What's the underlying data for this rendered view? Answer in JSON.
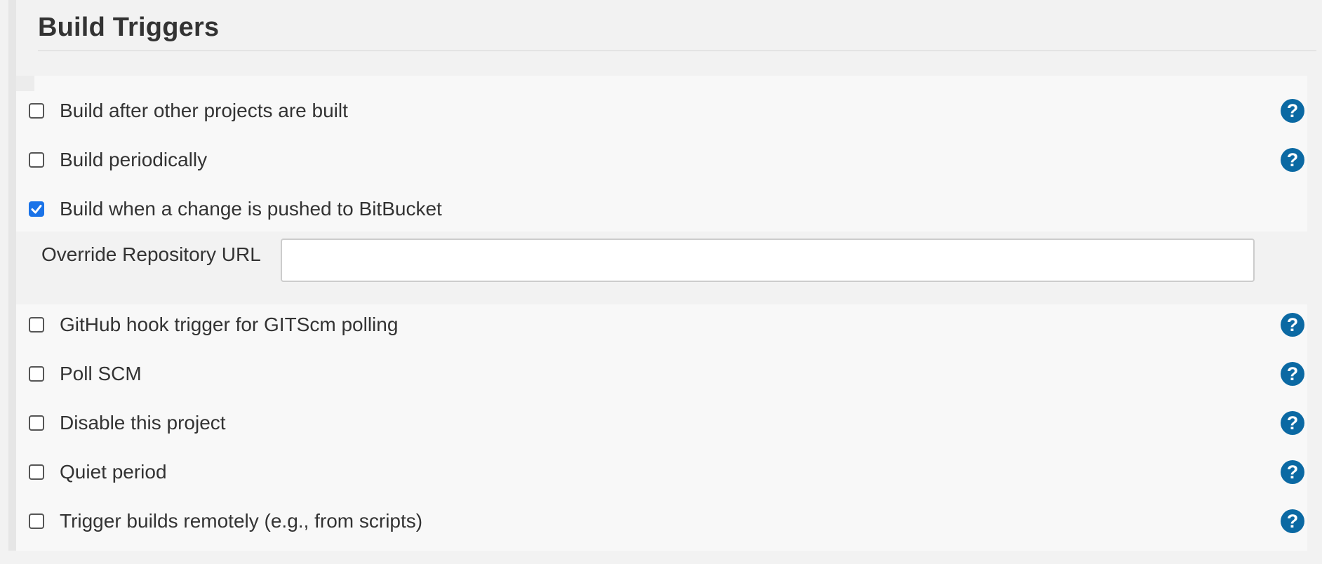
{
  "section": {
    "title": "Build Triggers"
  },
  "options": [
    {
      "label": "Build after other projects are built",
      "checked": false,
      "has_help": true
    },
    {
      "label": "Build periodically",
      "checked": false,
      "has_help": true
    },
    {
      "label": "Build when a change is pushed to BitBucket",
      "checked": true,
      "has_help": false
    },
    {
      "label": "GitHub hook trigger for GITScm polling",
      "checked": false,
      "has_help": true
    },
    {
      "label": "Poll SCM",
      "checked": false,
      "has_help": true
    },
    {
      "label": "Disable this project",
      "checked": false,
      "has_help": true
    },
    {
      "label": "Quiet period",
      "checked": false,
      "has_help": true
    },
    {
      "label": "Trigger builds remotely (e.g., from scripts)",
      "checked": false,
      "has_help": true
    }
  ],
  "bitbucket_config": {
    "override_url_label": "Override Repository URL",
    "override_url_value": ""
  },
  "help": {
    "glyph": "?"
  },
  "colors": {
    "accent_check": "#1a73e8",
    "help_icon": "#0b69a3",
    "background": "#f2f2f2"
  }
}
